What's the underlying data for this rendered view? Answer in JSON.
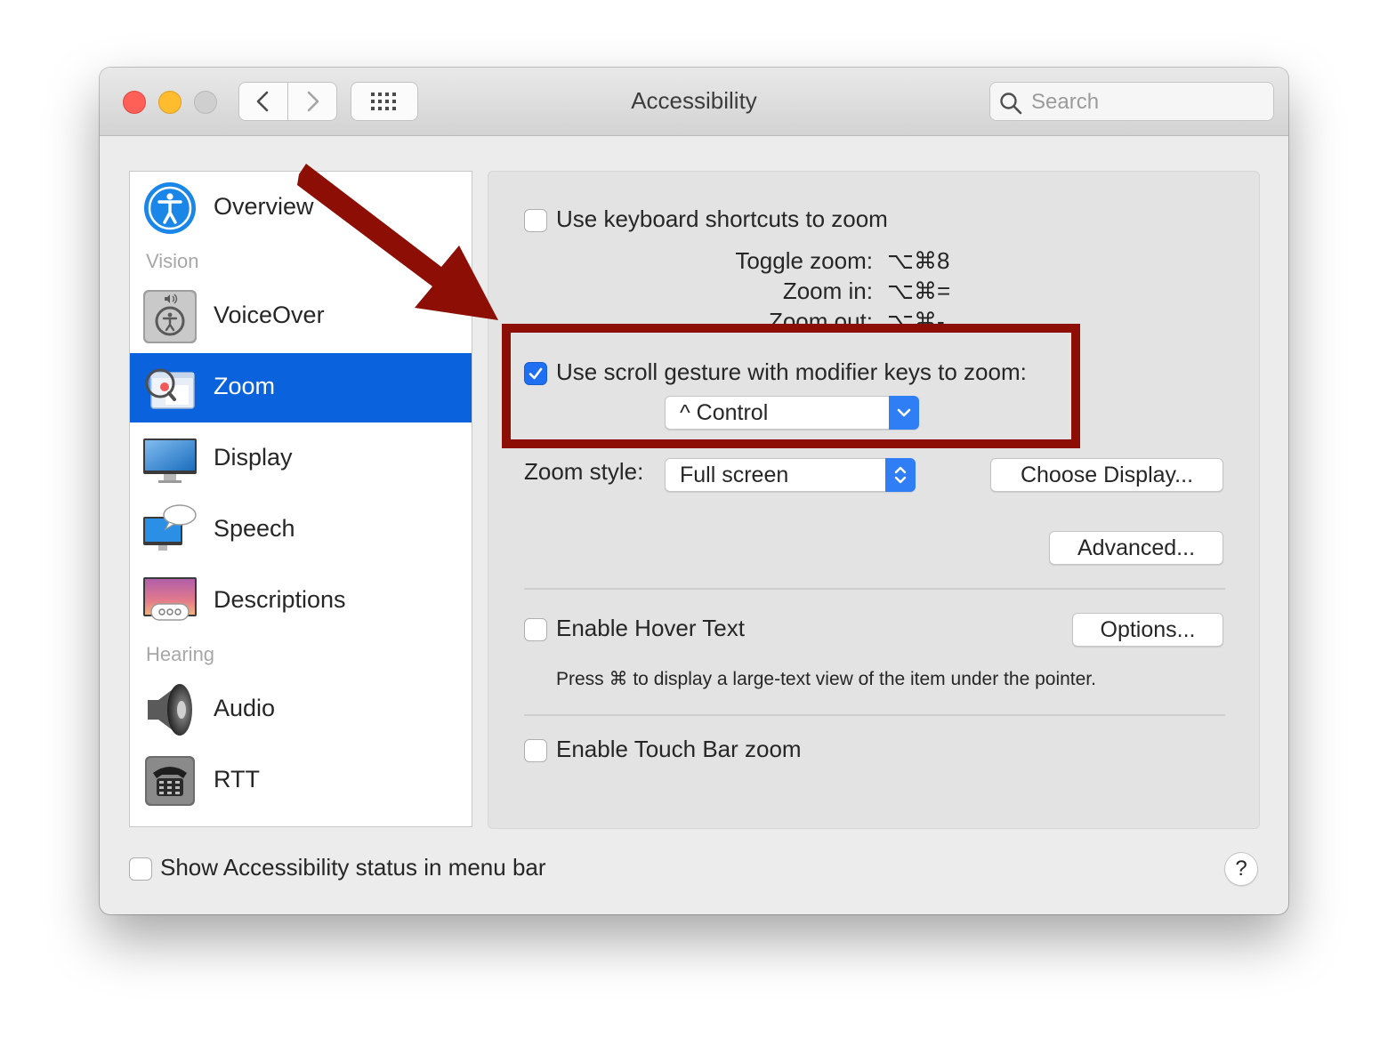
{
  "window": {
    "title": "Accessibility",
    "search_placeholder": "Search"
  },
  "sidebar": {
    "items": [
      {
        "label": "Overview",
        "icon": "accessibility-icon"
      },
      {
        "label": "VoiceOver",
        "icon": "voiceover-icon"
      },
      {
        "label": "Zoom",
        "icon": "zoom-icon",
        "selected": true
      },
      {
        "label": "Display",
        "icon": "display-icon"
      },
      {
        "label": "Speech",
        "icon": "speech-icon"
      },
      {
        "label": "Descriptions",
        "icon": "descriptions-icon"
      },
      {
        "label": "Audio",
        "icon": "audio-icon"
      },
      {
        "label": "RTT",
        "icon": "rtt-icon"
      }
    ],
    "headers": {
      "vision": "Vision",
      "hearing": "Hearing"
    }
  },
  "zoom": {
    "keyboard_shortcuts": {
      "label": "Use keyboard shortcuts to zoom",
      "checked": false
    },
    "shortcuts": [
      {
        "label": "Toggle zoom:",
        "keys": "⌥⌘8"
      },
      {
        "label": "Zoom in:",
        "keys": "⌥⌘="
      },
      {
        "label": "Zoom out:",
        "keys": "⌥⌘-"
      }
    ],
    "scroll_gesture": {
      "label": "Use scroll gesture with modifier keys to zoom:",
      "checked": true
    },
    "modifier_key": "^ Control",
    "zoom_style": {
      "label": "Zoom style:",
      "value": "Full screen"
    },
    "choose_display_button": "Choose Display...",
    "advanced_button": "Advanced...",
    "hover_text": {
      "label": "Enable Hover Text",
      "checked": false
    },
    "options_button": "Options...",
    "hover_text_hint": "Press ⌘ to display a large-text view of the item under the pointer.",
    "touch_bar_zoom": {
      "label": "Enable Touch Bar zoom",
      "checked": false
    }
  },
  "footer": {
    "show_status": {
      "label": "Show Accessibility status in menu bar",
      "checked": false
    },
    "help_label": "?"
  },
  "colors": {
    "selection": "#0a63dd",
    "checkbox_on": "#1f6ff2",
    "annotation": "#8c0e04"
  }
}
